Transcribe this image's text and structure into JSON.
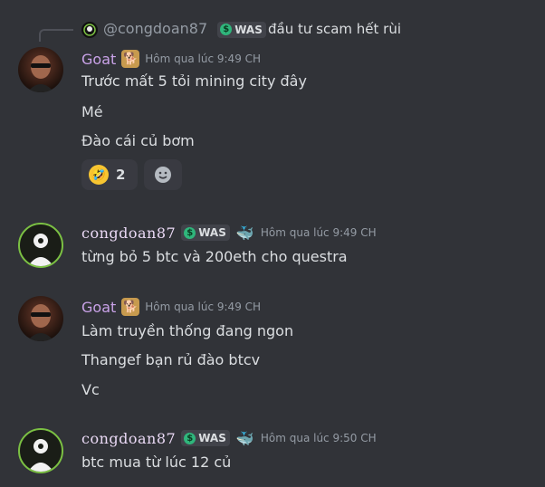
{
  "reply": {
    "name": "@congdoan87",
    "tag": "WAS",
    "text": "đầu tư scam hết rùi"
  },
  "messages": [
    {
      "author": "Goat",
      "timestamp": "Hôm qua lúc 9:49 CH",
      "lines": [
        "Trước mất 5 tỏi mining city đây",
        "Mé",
        "Đào cái củ bơm"
      ],
      "reaction": {
        "emoji": "rolling-on-floor-laughing",
        "count": "2"
      }
    },
    {
      "author": "congdoan87",
      "tag": "WAS",
      "timestamp": "Hôm qua lúc 9:49 CH",
      "lines": [
        "từng bỏ 5 btc  và 200eth cho questra"
      ]
    },
    {
      "author": "Goat",
      "timestamp": "Hôm qua lúc 9:49 CH",
      "lines": [
        "Làm truyền thống đang ngon",
        "Thangef bạn rủ đào btcv",
        "Vc"
      ]
    },
    {
      "author": "congdoan87",
      "tag": "WAS",
      "timestamp": "Hôm qua lúc 9:50 CH",
      "lines": [
        "btc mua từ lúc 12 củ"
      ]
    }
  ],
  "icons": {
    "goat_badge": "doge-icon",
    "whale_badge": "whale-icon",
    "add_reaction": "smiley-icon"
  },
  "colors": {
    "background": "#313338",
    "goat_name": "#c9a2e8",
    "congdoan_name": "#ead9f5",
    "timestamp": "#949ba4",
    "tag_green": "#2fb67c"
  }
}
